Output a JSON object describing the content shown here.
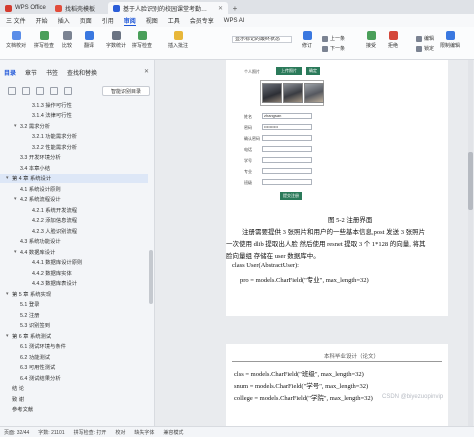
{
  "tabs": [
    {
      "label": "WPS Office",
      "color": "#d43b2f"
    },
    {
      "label": "找稻壳模板",
      "color": "#e24c3a"
    },
    {
      "label": "基于人脸识别的校园课堂考勤系统",
      "color": "#2b5dd8"
    }
  ],
  "menu": [
    "三 文件",
    "开始",
    "插入",
    "页面",
    "引用",
    "审阅",
    "视图",
    "工具",
    "会员专享",
    "WPS AI"
  ],
  "ribbon": {
    "doc_check": "文档校对",
    "spell_check": "拼写检查",
    "compare": "比较",
    "translate": "翻译",
    "count": "字数统计",
    "format": "拼写检查",
    "insert_comment": "插入批注",
    "show_markup": "显示标记的最终状态",
    "track": "修订",
    "prev": "上一条",
    "next": "下一条",
    "accept": "接受",
    "reject": "拒绝",
    "restrict": "限制编辑",
    "doc_permission": "文档权限",
    "more": "更多",
    "editor": "编辑",
    "lock": "锁定",
    "protect": "保护",
    "review": "审阅"
  },
  "sidebar": {
    "tabs": [
      "目录",
      "章节",
      "书签",
      "查找和替换"
    ],
    "smart_toc": "智能识别目录",
    "items": [
      {
        "label": "3.1.3 操作可行性",
        "level": 3
      },
      {
        "label": "3.1.4 法律可行性",
        "level": 3
      },
      {
        "label": "3.2 需求分析",
        "level": 2,
        "arrow": "▾"
      },
      {
        "label": "3.2.1 功能需求分析",
        "level": 3
      },
      {
        "label": "3.2.2 性能需求分析",
        "level": 3
      },
      {
        "label": "3.3 开发环境分析",
        "level": 2
      },
      {
        "label": "3.4 本章小结",
        "level": 2
      },
      {
        "label": "第 4 章  系统设计",
        "level": 1,
        "arrow": "▾",
        "active": true
      },
      {
        "label": "4.1 系统设计原则",
        "level": 2
      },
      {
        "label": "4.2 系统流程设计",
        "level": 2,
        "arrow": "▾"
      },
      {
        "label": "4.2.1 系统开发流程",
        "level": 3
      },
      {
        "label": "4.2.2 添加信息流程",
        "level": 3
      },
      {
        "label": "4.2.3 人脸识别流程",
        "level": 3
      },
      {
        "label": "4.3 系统功能设计",
        "level": 2
      },
      {
        "label": "4.4 数据库设计",
        "level": 2,
        "arrow": "▾"
      },
      {
        "label": "4.4.1 数据库设计原则",
        "level": 3
      },
      {
        "label": "4.4.2 数据库实体",
        "level": 3
      },
      {
        "label": "4.4.3 数据库表设计",
        "level": 3
      },
      {
        "label": "第 5 章  系统实现",
        "level": 1,
        "arrow": "▾"
      },
      {
        "label": "5.1 登录",
        "level": 2
      },
      {
        "label": "5.2 注册",
        "level": 2
      },
      {
        "label": "5.3 识别签到",
        "level": 2
      },
      {
        "label": "第 6 章  系统测试",
        "level": 1,
        "arrow": "▾"
      },
      {
        "label": "6.1 测试环境与条件",
        "level": 2
      },
      {
        "label": "6.2 功能测试",
        "level": 2
      },
      {
        "label": "6.3 可用性测试",
        "level": 2
      },
      {
        "label": "6.4 测试结果分析",
        "level": 2
      },
      {
        "label": "结    论",
        "level": 1
      },
      {
        "label": "致    谢",
        "level": 1
      },
      {
        "label": "参考文献",
        "level": 1
      }
    ]
  },
  "document": {
    "form_header": "个人照片",
    "form_btn_upload": "上传照片",
    "form_btn_confirm": "确定",
    "form_labels": [
      "姓名",
      "密码",
      "确认密码",
      "电话",
      "学号",
      "专业",
      "班级"
    ],
    "form_values": [
      "zhangsan",
      "••••••••••",
      "",
      "",
      "",
      "",
      ""
    ],
    "form_submit": "提交注册",
    "figure_caption": "图 5-2 注册界面",
    "paragraph_lines": [
      "注册需要提供 3 张照片和用户的一些基本信息,post 发送 3 张照片",
      "一次使用 dlib 提取出人脸 然后使用 resnet 提取 3 个 1*128 的向量, 将其",
      "脸向量组 存储在 user 数据库中。"
    ],
    "code_lines": [
      "class User(AbstractUser):",
      "pro = models.CharField(\"专业\", max_length=32)"
    ],
    "page2_header": "本科毕业设计（论文）",
    "page2_code": [
      "clss = models.CharField(\"班级\", max_length=32)",
      "snum = models.CharField(\"学号\", max_length=32)",
      "college = models.CharField(\"学院\", max_length=32)"
    ],
    "watermark": "CSDN @biyezuopinvip"
  },
  "status": {
    "page": "页面: 32/44",
    "words": "字数: 21101",
    "spell": "拼写检查: 打开",
    "proof": "校对",
    "missing_font": "缺失字体",
    "compat": "兼容模式"
  }
}
